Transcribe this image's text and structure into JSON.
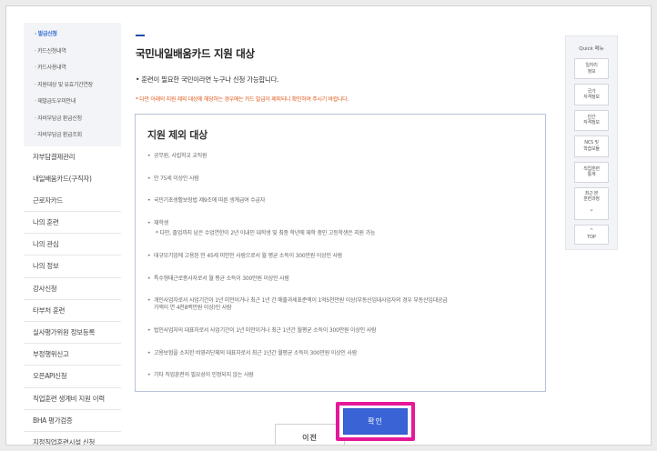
{
  "sidebar": {
    "sub_items": [
      "· 발급신청",
      "· 카드신청내역",
      "· 카드사용내역",
      "· 지원대상 및 유효기간연장",
      "· 재발급도우미안내",
      "· 자비부담금 환급신청",
      "· 자비부담금 환급조회"
    ],
    "main_items": [
      "자부담결제관리",
      "내일배움카드(구직자)",
      "근로자카드",
      "나의 훈련",
      "나의 관심",
      "나의 정보",
      "강사신청",
      "타부처 훈련",
      "실사평가위원 정보등록",
      "부정행위신고",
      "오픈API신청",
      "직업훈련 생계비 지원 이력",
      "BHA 평가검증",
      "지정직업훈련시설 신청"
    ]
  },
  "main": {
    "title": "국민내일배움카드 지원 대상",
    "intro": "• 훈련이 필요한 국민이라면 누구나 신청 가능합니다.",
    "notice": "* 다만 아래의 지원 제외 대상에 해당하는 경우에는 카드 발급이 제외되니 확인하여 주시기 바랍니다.",
    "panel_title": "지원 제외 대상",
    "exclusions": [
      {
        "text": "공무원, 사립학교 교직원"
      },
      {
        "text": "만 75세 이상인 사람"
      },
      {
        "text": "국민기초생활보장법 제9조에 따른 생계급여 수급자"
      },
      {
        "text": "재학생",
        "sub": "* 다만, 졸업까지 남은 수업연한이 2년 이내인 대학생 및 최종 학년에 재학 중인 고등학생은 지원 가능"
      },
      {
        "text": "대규모기업에 고용된 만 45세 미만인 사람으로서 월 평균 소득이 300만원 이상인 사람"
      },
      {
        "text": "특수형태근로종사자로서 월 평균 소득이 300만원 이상인 사람"
      },
      {
        "text": "개인사업자로서 사업기간이 1년 미만이거나 최근 1년 간 매출과세표준액이 1억5천만원 이상(부동산임대사업자의 경우 부동산임대공급",
        "cont": "가액이 연 4천8백만원 이상)인 사람"
      },
      {
        "text": "법인사업자의 대표자로서 사업기간이 1년 미만이거나 최근 1년간 월평균 소득이 300만원 이상인 사람"
      },
      {
        "text": "고용보험을 소지한 비영리단체의 대표자로서 최근 1년간 월평균 소득이 300만원 이상인 사람"
      },
      {
        "text": "기타 직업훈련의 필요성이 인정되지 않는 사람"
      }
    ],
    "btn_prev": "이전",
    "btn_ok": "확인"
  },
  "quick_menu": {
    "title": "Quick 메뉴",
    "items": [
      "일자리\n정보",
      "국가\n자격정보",
      "민간\n자격정보",
      "NCS 및\n학습모듈",
      "직업훈련\n통계",
      "최근 본\n훈련과정"
    ],
    "top_label": "TOP"
  },
  "colors": {
    "accent": "#3a63d6",
    "highlight": "#e6189a",
    "notice": "#e05a1e"
  }
}
